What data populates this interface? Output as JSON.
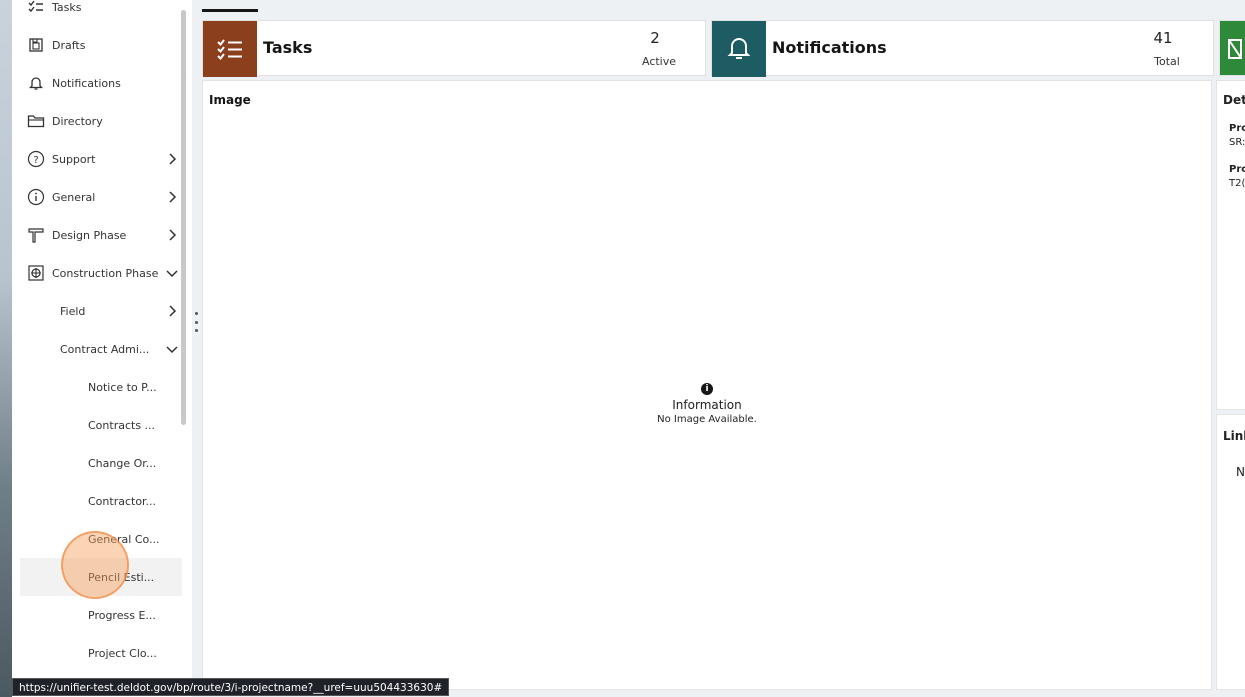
{
  "sidebar": {
    "items": [
      {
        "label": "Tasks",
        "icon": "tasks-icon"
      },
      {
        "label": "Drafts",
        "icon": "drafts-icon"
      },
      {
        "label": "Notifications",
        "icon": "bell-icon"
      },
      {
        "label": "Directory",
        "icon": "folder-icon"
      },
      {
        "label": "Support",
        "icon": "question-icon"
      },
      {
        "label": "General",
        "icon": "info-icon"
      },
      {
        "label": "Design Phase",
        "icon": "drafting-icon"
      },
      {
        "label": "Construction Phase",
        "icon": "crosshair-box-icon"
      },
      {
        "label": "Field"
      },
      {
        "label": "Contract Admi..."
      },
      {
        "label": "Notice to P..."
      },
      {
        "label": "Contracts ..."
      },
      {
        "label": "Change Or..."
      },
      {
        "label": "Contractor..."
      },
      {
        "label": "General Co..."
      },
      {
        "label": "Pencil Esti..."
      },
      {
        "label": "Progress E..."
      },
      {
        "label": "Project Clo..."
      }
    ]
  },
  "cards": {
    "tasks": {
      "title": "Tasks",
      "count": "2",
      "sub": "Active",
      "color": "#8b3f1c"
    },
    "notifications": {
      "title": "Notifications",
      "count": "41",
      "sub": "Total",
      "color": "#1e5c63"
    },
    "third": {
      "color": "#2e8a3a"
    }
  },
  "image_panel": {
    "title": "Image",
    "info_title": "Information",
    "info_msg": "No Image Available."
  },
  "details_panel": {
    "title": "Det",
    "f1_label": "Pro",
    "f1_value": "SR:",
    "f2_label": "Pro",
    "f2_value": "T2("
  },
  "links_panel": {
    "title": "Linl",
    "value": "N"
  },
  "status_url": "https://unifier-test.deldot.gov/bp/route/3/i-projectname?__uref=uuu504433630#"
}
